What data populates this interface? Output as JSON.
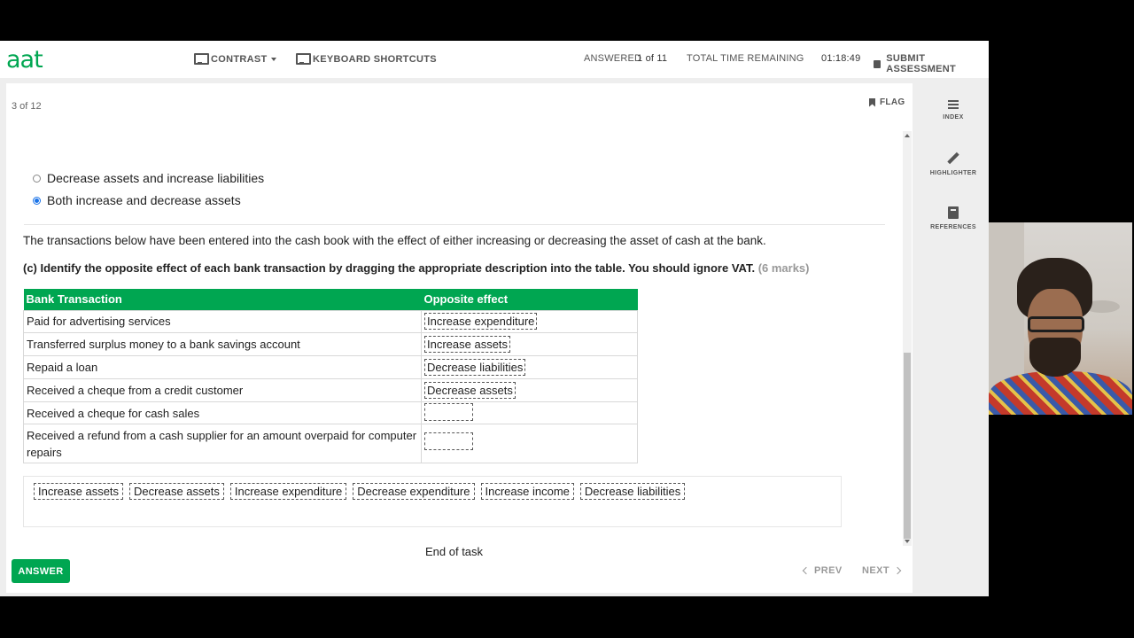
{
  "header": {
    "logo": "aat",
    "contrast_label": "CONTRAST",
    "shortcuts_label": "KEYBOARD SHORTCUTS",
    "answered_label": "ANSWERED",
    "answered_value": "1 of 11",
    "time_label": "TOTAL TIME REMAINING",
    "time_value": "01:18:49",
    "submit_label": "SUBMIT ASSESSMENT"
  },
  "question": {
    "counter": "3 of 12",
    "flag_label": "FLAG",
    "options": [
      {
        "label": "Decrease assets and increase liabilities",
        "selected": false
      },
      {
        "label": "Both increase and decrease assets",
        "selected": true
      }
    ],
    "intro": "The transactions below have been entered into the cash book with the effect of either increasing or decreasing the asset of cash at the bank.",
    "instruction": "(c) Identify the opposite effect of each bank transaction by dragging the appropriate description into the table. You should ignore VAT.",
    "marks": "(6 marks)",
    "table": {
      "headers": [
        "Bank Transaction",
        "Opposite effect"
      ],
      "rows": [
        {
          "transaction": "Paid for advertising services",
          "effect": "Increase expenditure"
        },
        {
          "transaction": "Transferred surplus money to a bank savings account",
          "effect": "Increase assets"
        },
        {
          "transaction": "Repaid a loan",
          "effect": "Decrease liabilities"
        },
        {
          "transaction": "Received a cheque from a credit customer",
          "effect": "Decrease assets"
        },
        {
          "transaction": "Received a cheque for cash sales",
          "effect": ""
        },
        {
          "transaction": "Received a refund from a cash supplier for an amount overpaid for computer repairs",
          "effect": ""
        }
      ]
    },
    "choices": [
      "Increase assets",
      "Decrease assets",
      "Increase expenditure",
      "Decrease expenditure",
      "Increase income",
      "Decrease liabilities"
    ],
    "end_text": "End of task"
  },
  "footer": {
    "answer_label": "ANSWER",
    "prev_label": "PREV",
    "next_label": "NEXT"
  },
  "sidebar": {
    "index_label": "INDEX",
    "highlighter_label": "HIGHLIGHTER",
    "references_label": "REFERENCES"
  },
  "colors": {
    "brand": "#00a651",
    "selected_radio": "#1a73e8"
  }
}
